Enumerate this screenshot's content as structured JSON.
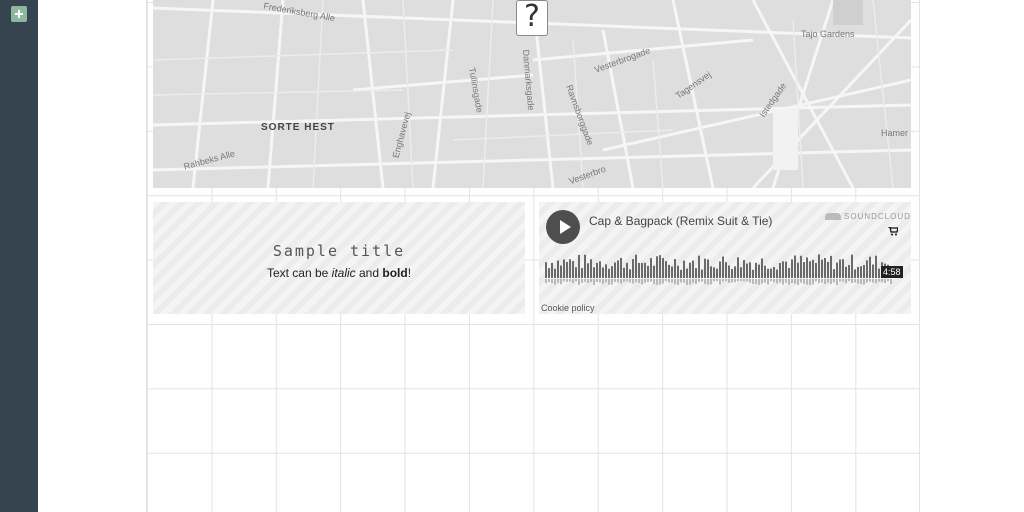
{
  "sidebar": {
    "add_icon": "plus-square-icon"
  },
  "map": {
    "labels": [
      "Frederiksberg Alle",
      "SORTE HEST",
      "Vesterbrogade",
      "Tagensvej",
      "Tullinsgade",
      "Danmarksgade",
      "Ravnsborggade",
      "Enghavevej",
      "Vesterbro",
      "Istedgade",
      "Rahbeks Alle",
      "Tajo Gardens",
      "Hamer"
    ],
    "marker_icon": "question-mark-icon",
    "marker_glyph": "?"
  },
  "text_card": {
    "title": "Sample title",
    "body_prefix": "Text can be ",
    "body_italic": "italic",
    "body_mid": " and ",
    "body_bold": "bold",
    "body_suffix": "!"
  },
  "soundcloud": {
    "track_title": "Cap & Bagpack (Remix Suit & Tie)",
    "brand": "SOUNDCLOUD",
    "duration": "4:58",
    "cookie_policy": "Cookie policy",
    "play_icon": "play-icon",
    "cart_icon": "cart-icon"
  },
  "colors": {
    "sidebar": "#35444f",
    "accent": "#8fb79e",
    "map_bg": "#dedede"
  }
}
